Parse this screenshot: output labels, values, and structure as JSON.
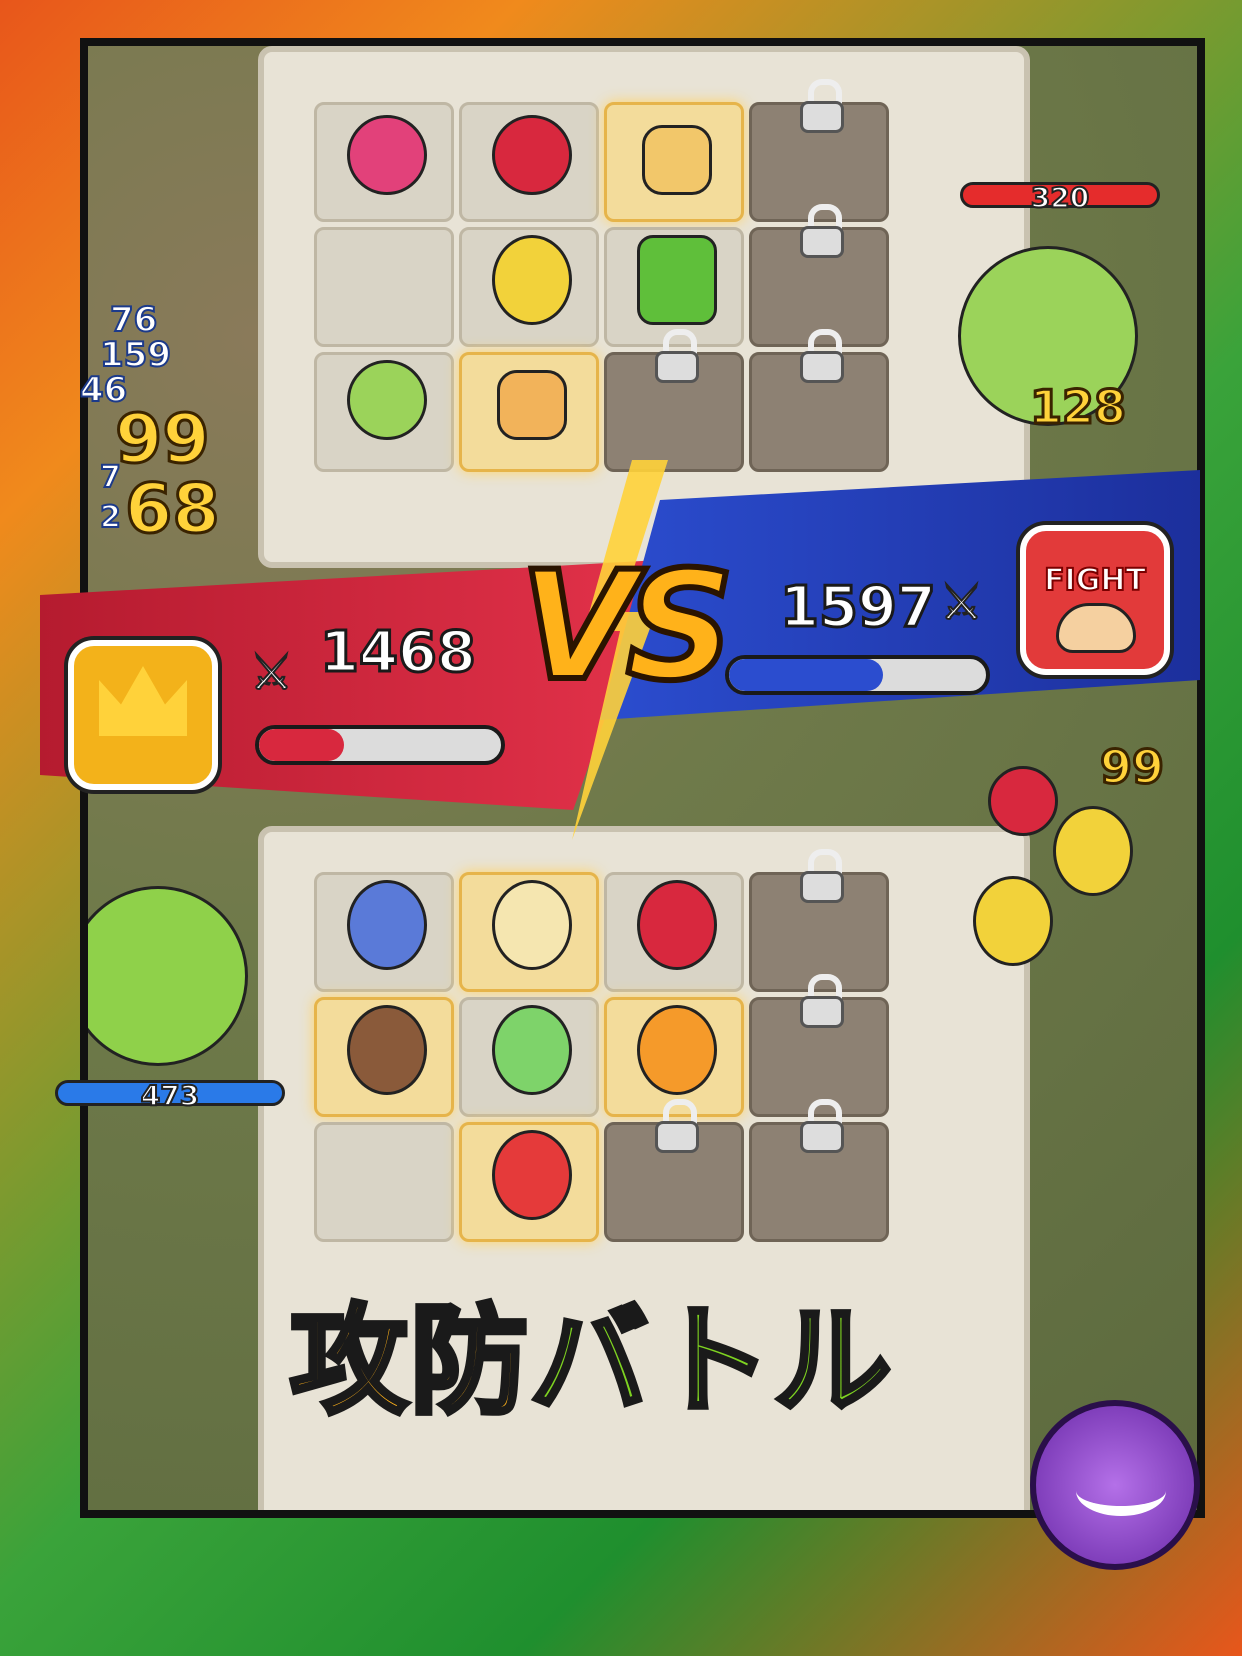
{
  "battle": {
    "left_team": {
      "power": "1468",
      "progress": 0.35,
      "color": "#d8283e"
    },
    "right_team": {
      "power": "1597",
      "progress": 0.6,
      "color": "#2b4dcf",
      "avatar_label": "FIGHT"
    },
    "vs_label": "VS"
  },
  "damage_numbers": {
    "small": [
      "76",
      "159",
      "46",
      "7",
      "2"
    ],
    "large": [
      "99",
      "68"
    ],
    "right_side": [
      "128",
      "99"
    ]
  },
  "enemy_hp": {
    "top_right": "320",
    "bottom_left": "473"
  },
  "title": {
    "part1": "攻防",
    "part2": "バトル"
  },
  "icons": {
    "left_avatar": "crowned-king-icon",
    "right_avatar": "fight-helmet-icon",
    "power": "crossed-swords-icon",
    "lock": "padlock-icon",
    "badge": "purple-rose-emblem-icon"
  },
  "colors": {
    "accent_orange": "#f08a1c",
    "accent_green": "#3aa33a",
    "gold": "#ffd23a"
  }
}
